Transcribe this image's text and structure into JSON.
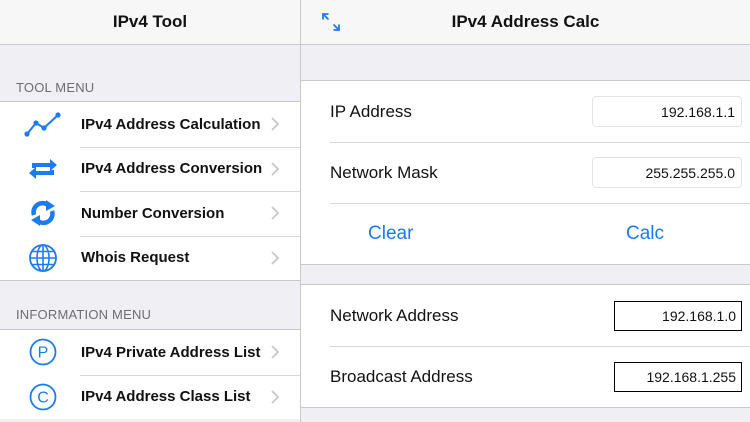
{
  "master": {
    "title": "IPv4 Tool",
    "tool_menu_header": "TOOL MENU",
    "tool_items": [
      {
        "label": "IPv4 Address Calculation",
        "icon": "line-chart-icon"
      },
      {
        "label": "IPv4 Address Conversion",
        "icon": "swap-arrows-icon"
      },
      {
        "label": "Number Conversion",
        "icon": "sync-arrows-icon"
      },
      {
        "label": "Whois Request",
        "icon": "globe-icon"
      }
    ],
    "info_menu_header": "INFORMATION MENU",
    "info_items": [
      {
        "label": "IPv4 Private Address List",
        "icon": "circle-p-icon",
        "glyph": "P"
      },
      {
        "label": "IPv4 Address Class List",
        "icon": "circle-c-icon",
        "glyph": "C"
      }
    ]
  },
  "detail": {
    "title": "IPv4 Address Calc",
    "ip_label": "IP Address",
    "ip_value": "192.168.1.1",
    "mask_label": "Network Mask",
    "mask_value": "255.255.255.0",
    "clear_label": "Clear",
    "calc_label": "Calc",
    "network_label": "Network Address",
    "network_value": "192.168.1.0",
    "broadcast_label": "Broadcast Address",
    "broadcast_value": "192.168.1.255"
  },
  "colors": {
    "accent": "#1a7cf5",
    "background": "#efeff4",
    "navbar": "#f7f7f8"
  }
}
